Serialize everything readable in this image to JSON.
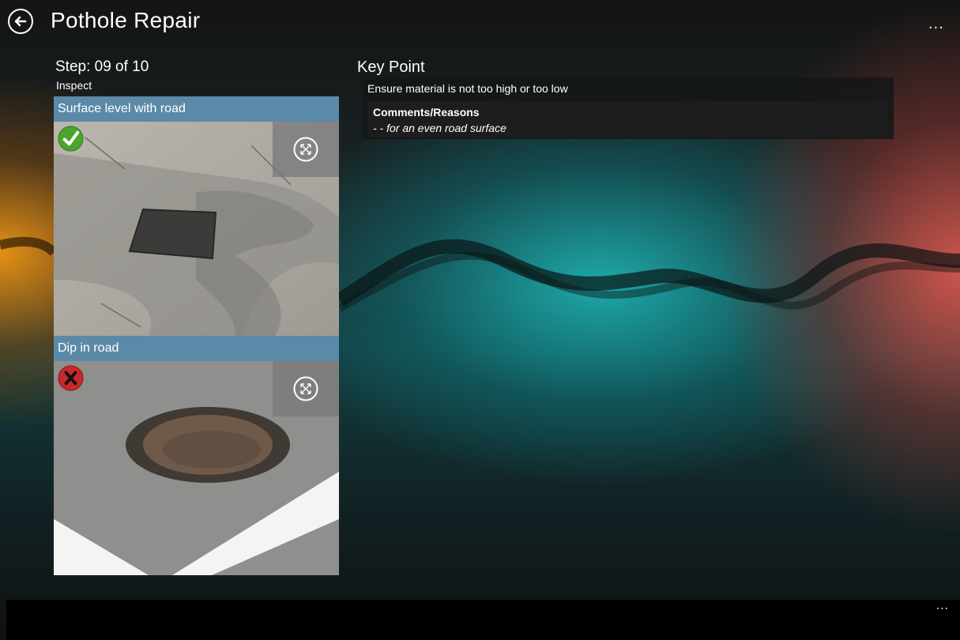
{
  "header": {
    "title": "Pothole Repair",
    "back_icon": "back-arrow-icon",
    "more_label": "..."
  },
  "step": {
    "label": "Step: 09 of 10",
    "subtitle": "Inspect"
  },
  "cards": [
    {
      "label": "Surface level with road",
      "status": "correct",
      "status_icon": "green-check-icon",
      "expand_icon": "expand-icon"
    },
    {
      "label": "Dip in road",
      "status": "incorrect",
      "status_icon": "red-x-icon",
      "expand_icon": "expand-icon"
    }
  ],
  "key_point": {
    "title": "Key Point",
    "text": "Ensure material is not too high or too low",
    "comments_heading": "Comments/Reasons",
    "comments_text": "- - for an even road surface"
  },
  "app_bar": {
    "more_label": "..."
  },
  "colors": {
    "card_label_bg": "#5b8aa8",
    "correct_green": "#4aa52b",
    "incorrect_red": "#c8282a"
  }
}
